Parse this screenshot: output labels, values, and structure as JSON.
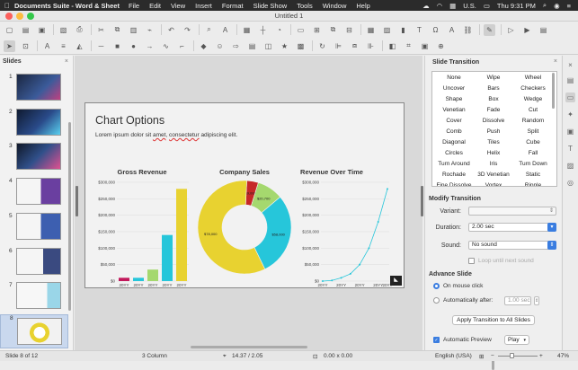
{
  "menubar": {
    "app_name": "Documents Suite - Word & Sheet",
    "items": [
      "File",
      "Edit",
      "View",
      "Insert",
      "Format",
      "Slide Show",
      "Tools",
      "Window",
      "Help"
    ],
    "input_source": "U.S.",
    "clock": "Thu 9:31 PM"
  },
  "window": {
    "title": "Untitled 1"
  },
  "slides_pane": {
    "title": "Slides",
    "slide_numbers": [
      "1",
      "2",
      "3",
      "4",
      "5",
      "6",
      "7",
      "8"
    ],
    "selected": 8
  },
  "slide": {
    "title": "Chart Options",
    "subtitle_parts": [
      "Lorem ipsum dolor sit ",
      "amet",
      ", ",
      "consectetur",
      " adipiscing elit."
    ]
  },
  "chart_data": [
    {
      "type": "bar",
      "title": "Gross Revenue",
      "categories": [
        "20YY",
        "20YY",
        "20YY",
        "20YY",
        "20YY"
      ],
      "values": [
        10000,
        10000,
        35000,
        140000,
        280000
      ],
      "ylim": [
        0,
        300000
      ],
      "yticks": [
        "$0",
        "$50,000",
        "$100,000",
        "$150,000",
        "$200,000",
        "$250,000",
        "$300,000"
      ],
      "colors": [
        "#c2185b",
        "#26c6da",
        "#a5d86e",
        "#26c6da",
        "#e8d230"
      ]
    },
    {
      "type": "pie",
      "title": "Company Sales",
      "slices": [
        {
          "value": 0.04,
          "label": "$9,000",
          "color": "#c62828"
        },
        {
          "value": 0.09,
          "label": "$20,700",
          "color": "#a5d86e"
        },
        {
          "value": 0.29,
          "label": "$58,000",
          "color": "#26c6da"
        },
        {
          "value": 0.58,
          "label": "$78,000",
          "color": "#e8d230"
        }
      ]
    },
    {
      "type": "line",
      "title": "Revenue Over Time",
      "x": [
        "20YY",
        "20YY",
        "20YY",
        "20YY",
        "20YY",
        "20YY",
        "20YY",
        "20YY"
      ],
      "values": [
        0,
        2000,
        10000,
        22000,
        50000,
        100000,
        180000,
        280000
      ],
      "ylim": [
        0,
        300000
      ],
      "yticks": [
        "$0",
        "$50,000",
        "$100,000",
        "$150,000",
        "$200,000",
        "$250,000",
        "$300,000"
      ],
      "color": "#26c6da"
    }
  ],
  "panel": {
    "title": "Slide Transition",
    "transitions": [
      "None",
      "Wipe",
      "Wheel",
      "Uncover",
      "Bars",
      "Checkers",
      "Shape",
      "Box",
      "Wedge",
      "Venetian",
      "Fade",
      "Cut",
      "Cover",
      "Dissolve",
      "Random",
      "Comb",
      "Push",
      "Split",
      "Diagonal",
      "Tiles",
      "Cube",
      "Circles",
      "Helix",
      "Fall",
      "Turn Around",
      "Iris",
      "Turn Down",
      "Rochade",
      "3D Venetian",
      "Static",
      "Fine Dissolve",
      "Vortex",
      "Ripple"
    ],
    "modify_title": "Modify Transition",
    "variant_label": "Variant:",
    "duration_label": "Duration:",
    "duration_value": "2.00 sec",
    "sound_label": "Sound:",
    "sound_value": "No sound",
    "loop_label": "Loop until next sound",
    "advance_title": "Advance Slide",
    "on_click_label": "On mouse click",
    "auto_label": "Automatically after:",
    "auto_value": "1.00 sec",
    "apply_all_label": "Apply Transition to All Slides",
    "auto_preview_label": "Automatic Preview",
    "play_label": "Play"
  },
  "statusbar": {
    "slide_pos": "Slide 8 of 12",
    "layout": "3 Column",
    "cursor_pos": "14.37 / 2.05",
    "size": "0.00 x 0.00",
    "language": "English (USA)",
    "zoom": "47%"
  }
}
